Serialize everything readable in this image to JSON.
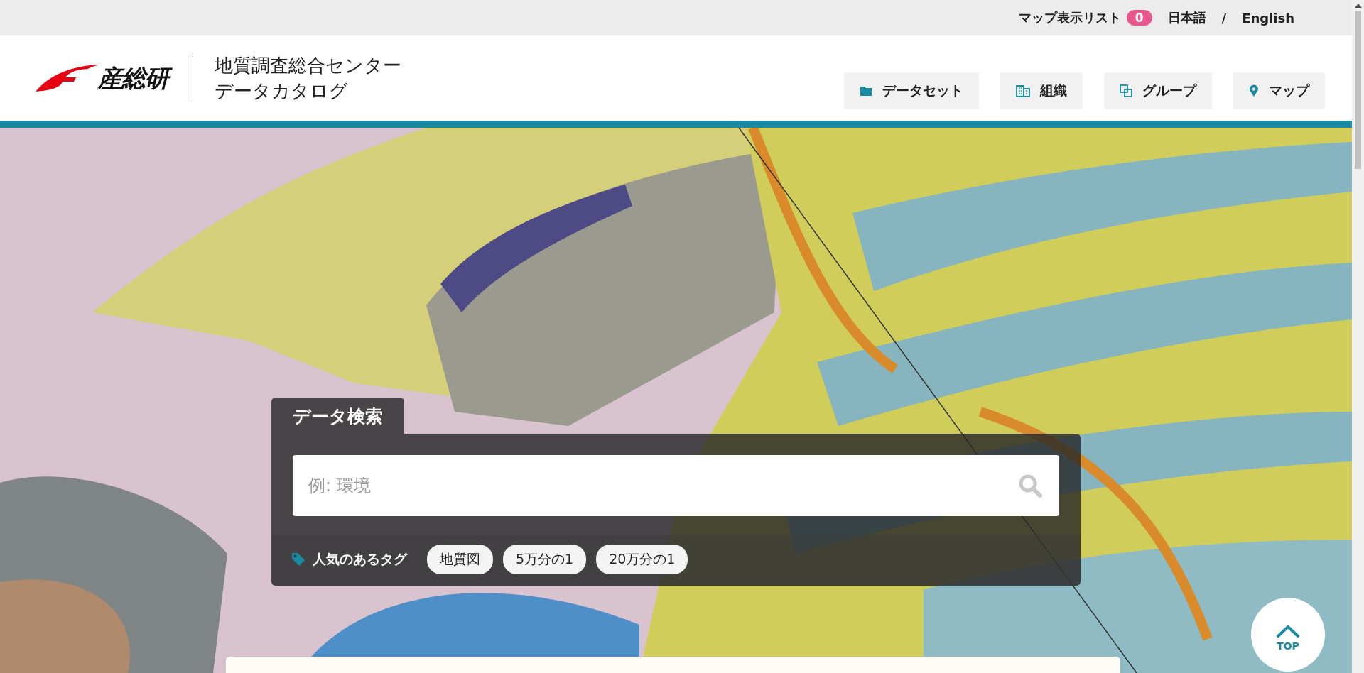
{
  "top_bar": {
    "map_list_label": "マップ表示リスト",
    "map_list_count": "0",
    "languages": [
      "日本語",
      "English"
    ],
    "separator": "/"
  },
  "header": {
    "logo_text": "産総研",
    "site_title_lines": [
      "地質調査総合センター",
      "データカタログ"
    ],
    "nav": [
      "データセット",
      "組織",
      "グループ",
      "マップ"
    ]
  },
  "search": {
    "title": "データ検索",
    "placeholder": "例: 環境",
    "popular_tags_label": "人気のあるタグ",
    "tags": [
      "地質図",
      "5万分の1",
      "20万分の1"
    ]
  },
  "back_to_top": "TOP"
}
